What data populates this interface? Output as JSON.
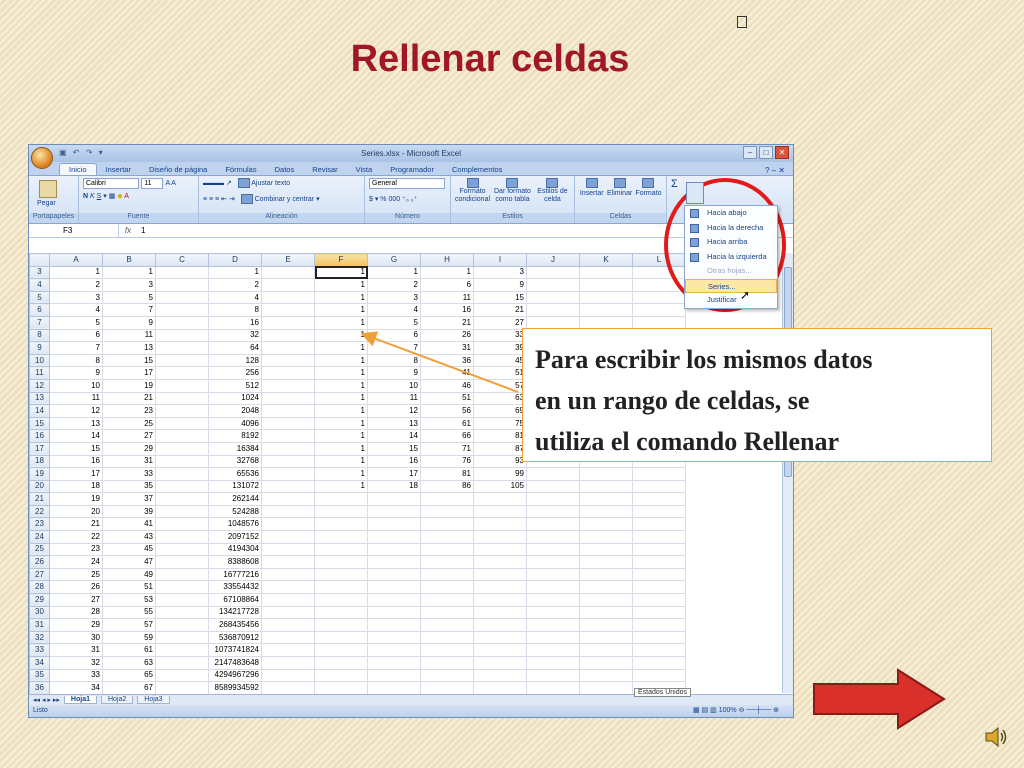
{
  "slide": {
    "title": "Rellenar celdas",
    "top_glyph": "",
    "callout_lines": [
      "Para escribir los mismos datos",
      "en un rango de celdas, se",
      "utiliza el comando Rellenar"
    ],
    "next_icon": "next-arrow-icon",
    "speaker_icon": "speaker-icon",
    "colors": {
      "title": "#a0172a",
      "callout_border": "#f0a03a",
      "highlight_circle": "#e21a1a",
      "next_arrow": "#d9302b"
    }
  },
  "excel": {
    "window_title": "Series.xlsx - Microsoft Excel",
    "tabs": [
      "Inicio",
      "Insertar",
      "Diseño de página",
      "Fórmulas",
      "Datos",
      "Revisar",
      "Vista",
      "Programador",
      "Complementos"
    ],
    "ribbon": {
      "paste_label": "Pegar",
      "font_name": "Calibri",
      "font_size": "11",
      "wrap_text": "Ajustar texto",
      "merge_center": "Combinar y centrar",
      "number_format": "General",
      "conditional_format": "Formato condicional",
      "table_format": "Dar formato como tabla",
      "cell_styles": "Estilos de celda",
      "insert": "Insertar",
      "delete": "Eliminar",
      "format": "Formato",
      "group_labels": [
        "Portapapeles",
        "Fuente",
        "Alineación",
        "Número",
        "Estilos",
        "Celdas"
      ]
    },
    "name_box": "F3",
    "formula_value": "1",
    "columns": [
      "A",
      "B",
      "C",
      "D",
      "E",
      "F",
      "G",
      "H",
      "I",
      "J",
      "K",
      "L"
    ],
    "rows": [
      {
        "n": "3",
        "A": "1",
        "B": "1",
        "D": "1",
        "F": "1",
        "G": "1",
        "H": "1",
        "I": "3"
      },
      {
        "n": "4",
        "A": "2",
        "B": "3",
        "D": "2",
        "F": "1",
        "G": "2",
        "H": "6",
        "I": "9"
      },
      {
        "n": "5",
        "A": "3",
        "B": "5",
        "D": "4",
        "F": "1",
        "G": "3",
        "H": "11",
        "I": "15"
      },
      {
        "n": "6",
        "A": "4",
        "B": "7",
        "D": "8",
        "F": "1",
        "G": "4",
        "H": "16",
        "I": "21"
      },
      {
        "n": "7",
        "A": "5",
        "B": "9",
        "D": "16",
        "F": "1",
        "G": "5",
        "H": "21",
        "I": "27"
      },
      {
        "n": "8",
        "A": "6",
        "B": "11",
        "D": "32",
        "F": "1",
        "G": "6",
        "H": "26",
        "I": "33"
      },
      {
        "n": "9",
        "A": "7",
        "B": "13",
        "D": "64",
        "F": "1",
        "G": "7",
        "H": "31",
        "I": "39"
      },
      {
        "n": "10",
        "A": "8",
        "B": "15",
        "D": "128",
        "F": "1",
        "G": "8",
        "H": "36",
        "I": "45"
      },
      {
        "n": "11",
        "A": "9",
        "B": "17",
        "D": "256",
        "F": "1",
        "G": "9",
        "H": "41",
        "I": "51"
      },
      {
        "n": "12",
        "A": "10",
        "B": "19",
        "D": "512",
        "F": "1",
        "G": "10",
        "H": "46",
        "I": "57"
      },
      {
        "n": "13",
        "A": "11",
        "B": "21",
        "D": "1024",
        "F": "1",
        "G": "11",
        "H": "51",
        "I": "63"
      },
      {
        "n": "14",
        "A": "12",
        "B": "23",
        "D": "2048",
        "F": "1",
        "G": "12",
        "H": "56",
        "I": "69"
      },
      {
        "n": "15",
        "A": "13",
        "B": "25",
        "D": "4096",
        "F": "1",
        "G": "13",
        "H": "61",
        "I": "75"
      },
      {
        "n": "16",
        "A": "14",
        "B": "27",
        "D": "8192",
        "F": "1",
        "G": "14",
        "H": "66",
        "I": "81"
      },
      {
        "n": "17",
        "A": "15",
        "B": "29",
        "D": "16384",
        "F": "1",
        "G": "15",
        "H": "71",
        "I": "87"
      },
      {
        "n": "18",
        "A": "16",
        "B": "31",
        "D": "32768",
        "F": "1",
        "G": "16",
        "H": "76",
        "I": "93"
      },
      {
        "n": "19",
        "A": "17",
        "B": "33",
        "D": "65536",
        "F": "1",
        "G": "17",
        "H": "81",
        "I": "99"
      },
      {
        "n": "20",
        "A": "18",
        "B": "35",
        "D": "131072",
        "F": "1",
        "G": "18",
        "H": "86",
        "I": "105"
      },
      {
        "n": "21",
        "A": "19",
        "B": "37",
        "D": "262144"
      },
      {
        "n": "22",
        "A": "20",
        "B": "39",
        "D": "524288"
      },
      {
        "n": "23",
        "A": "21",
        "B": "41",
        "D": "1048576"
      },
      {
        "n": "24",
        "A": "22",
        "B": "43",
        "D": "2097152"
      },
      {
        "n": "25",
        "A": "23",
        "B": "45",
        "D": "4194304"
      },
      {
        "n": "26",
        "A": "24",
        "B": "47",
        "D": "8388608"
      },
      {
        "n": "27",
        "A": "25",
        "B": "49",
        "D": "16777216"
      },
      {
        "n": "28",
        "A": "26",
        "B": "51",
        "D": "33554432"
      },
      {
        "n": "29",
        "A": "27",
        "B": "53",
        "D": "67108864"
      },
      {
        "n": "30",
        "A": "28",
        "B": "55",
        "D": "134217728"
      },
      {
        "n": "31",
        "A": "29",
        "B": "57",
        "D": "268435456"
      },
      {
        "n": "32",
        "A": "30",
        "B": "59",
        "D": "536870912"
      },
      {
        "n": "33",
        "A": "31",
        "B": "61",
        "D": "1073741824"
      },
      {
        "n": "34",
        "A": "32",
        "B": "63",
        "D": "2147483648"
      },
      {
        "n": "35",
        "A": "33",
        "B": "65",
        "D": "4294967296"
      },
      {
        "n": "36",
        "A": "34",
        "B": "67",
        "D": "8589934592"
      }
    ],
    "fill_menu": [
      {
        "label": "Hacia abajo",
        "state": "normal"
      },
      {
        "label": "Hacia la derecha",
        "state": "normal"
      },
      {
        "label": "Hacia arriba",
        "state": "normal"
      },
      {
        "label": "Hacia la izquierda",
        "state": "normal"
      },
      {
        "label": "Otras hojas...",
        "state": "disabled"
      },
      {
        "label": "Series...",
        "state": "highlighted"
      },
      {
        "label": "Justificar",
        "state": "normal"
      }
    ],
    "sheet_tabs": [
      "Hoja1",
      "Hoja2",
      "Hoja3"
    ],
    "active_sheet": "Hoja1",
    "status_text": "Listo",
    "tooltip": "Estados Unidos",
    "zoom": "100%"
  }
}
